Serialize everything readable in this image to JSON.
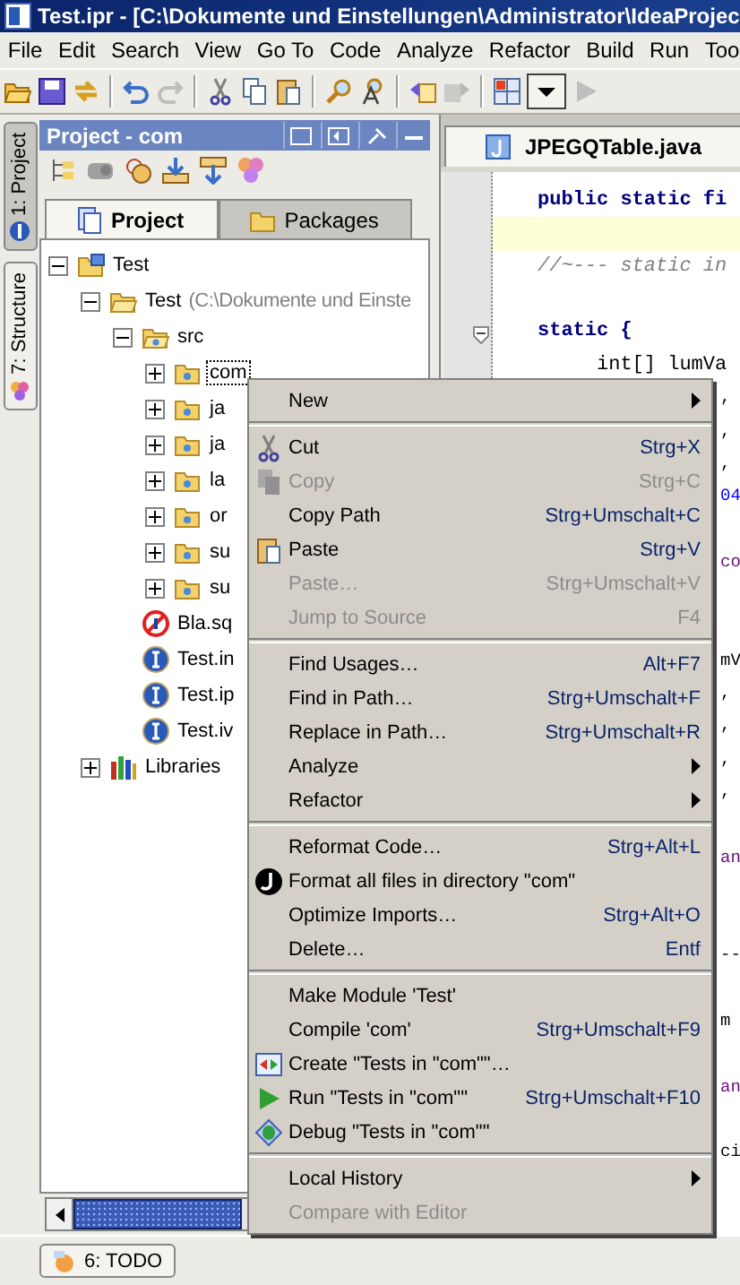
{
  "window": {
    "title": "Test.ipr - [C:\\Dokumente und Einstellungen\\Administrator\\IdeaProjec"
  },
  "menu_bar": [
    "File",
    "Edit",
    "Search",
    "View",
    "Go To",
    "Code",
    "Analyze",
    "Refactor",
    "Build",
    "Run",
    "Too"
  ],
  "toolbar": [
    {
      "kind": "open",
      "disabled": false
    },
    {
      "kind": "save",
      "disabled": false
    },
    {
      "kind": "sync",
      "disabled": false
    },
    {
      "kind": "separator"
    },
    {
      "kind": "undo",
      "disabled": false
    },
    {
      "kind": "redo",
      "disabled": true
    },
    {
      "kind": "separator"
    },
    {
      "kind": "cut",
      "disabled": false
    },
    {
      "kind": "copy",
      "disabled": false
    },
    {
      "kind": "paste",
      "disabled": false
    },
    {
      "kind": "separator"
    },
    {
      "kind": "find",
      "disabled": false
    },
    {
      "kind": "replace",
      "disabled": false
    },
    {
      "kind": "separator"
    },
    {
      "kind": "back",
      "disabled": false
    },
    {
      "kind": "forward",
      "disabled": true
    },
    {
      "kind": "separator"
    },
    {
      "kind": "structure",
      "disabled": false
    },
    {
      "kind": "dropdown",
      "disabled": false
    },
    {
      "kind": "run",
      "disabled": true
    }
  ],
  "tool_strip": [
    {
      "label": "1: Project",
      "selected": true
    },
    {
      "label": "7: Structure",
      "selected": false
    }
  ],
  "project_panel": {
    "title": "Project - com",
    "tabs": [
      {
        "label": "Project",
        "selected": true
      },
      {
        "label": "Packages",
        "selected": false
      }
    ],
    "tree": [
      {
        "label": "Test",
        "kind": "module",
        "expanded": true,
        "selected": false,
        "children": [
          {
            "label": "Test",
            "note": "(C:\\Dokumente und Einste",
            "kind": "folder",
            "expanded": true,
            "selected": false,
            "children": [
              {
                "label": "src",
                "kind": "source",
                "expanded": true,
                "selected": false,
                "children": [
                  {
                    "label": "com",
                    "kind": "package",
                    "expanded": false,
                    "selected": true
                  },
                  {
                    "label": "ja",
                    "kind": "package",
                    "expanded": false,
                    "selected": false
                  },
                  {
                    "label": "ja",
                    "kind": "package",
                    "expanded": false,
                    "selected": false
                  },
                  {
                    "label": "la",
                    "kind": "package",
                    "expanded": false,
                    "selected": false
                  },
                  {
                    "label": "or",
                    "kind": "package",
                    "expanded": false,
                    "selected": false
                  },
                  {
                    "label": "su",
                    "kind": "package",
                    "expanded": false,
                    "selected": false
                  },
                  {
                    "label": "su",
                    "kind": "package",
                    "expanded": false,
                    "selected": false
                  }
                ]
              },
              {
                "label": "Bla.sq",
                "kind": "sql",
                "selected": false
              },
              {
                "label": "Test.in",
                "kind": "idea",
                "selected": false
              },
              {
                "label": "Test.ip",
                "kind": "idea",
                "selected": false
              },
              {
                "label": "Test.iv",
                "kind": "idea",
                "selected": false
              }
            ]
          },
          {
            "label": "Libraries",
            "kind": "libraries",
            "expanded": false,
            "selected": false
          }
        ]
      }
    ]
  },
  "editor": {
    "tabs": [
      {
        "label": "JPEGQTable.java",
        "selected": true
      }
    ],
    "lines": [
      {
        "kind": "keyword",
        "text": "public static fi"
      },
      {
        "kind": "current"
      },
      {
        "kind": "comment",
        "text": "//~--- static in"
      },
      {
        "kind": "blank"
      },
      {
        "kind": "keyword",
        "text": "static {"
      },
      {
        "kind": "code",
        "text": "int[] lumVa"
      },
      {
        "kind": "punct",
        "text": ","
      },
      {
        "kind": "punct",
        "text": ","
      },
      {
        "kind": "punct",
        "text": ","
      },
      {
        "kind": "number",
        "text": "04"
      },
      {
        "kind": "blank"
      },
      {
        "kind": "field",
        "text": "co"
      },
      {
        "kind": "blank"
      },
      {
        "kind": "blank"
      },
      {
        "kind": "punct",
        "text": "mV"
      },
      {
        "kind": "punct",
        "text": ","
      },
      {
        "kind": "punct",
        "text": ","
      },
      {
        "kind": "punct",
        "text": ","
      },
      {
        "kind": "punct",
        "text": ","
      },
      {
        "kind": "blank"
      },
      {
        "kind": "field",
        "text": "an"
      },
      {
        "kind": "blank"
      },
      {
        "kind": "blank"
      },
      {
        "kind": "punct",
        "text": "--"
      },
      {
        "kind": "blank"
      },
      {
        "kind": "punct",
        "text": "m"
      },
      {
        "kind": "blank"
      },
      {
        "kind": "field",
        "text": "an"
      },
      {
        "kind": "blank"
      },
      {
        "kind": "punct",
        "text": "ci"
      }
    ]
  },
  "context_menu": [
    {
      "kind": "item",
      "label": "New",
      "submenu": true,
      "disabled": false
    },
    {
      "kind": "separator"
    },
    {
      "kind": "item",
      "label": "Cut",
      "shortcut": "Strg+X",
      "disabled": false
    },
    {
      "kind": "item",
      "label": "Copy",
      "shortcut": "Strg+C",
      "disabled": true
    },
    {
      "kind": "item",
      "label": "Copy Path",
      "shortcut": "Strg+Umschalt+C",
      "disabled": false
    },
    {
      "kind": "item",
      "label": "Paste",
      "shortcut": "Strg+V",
      "disabled": false
    },
    {
      "kind": "item",
      "label": "Paste…",
      "shortcut": "Strg+Umschalt+V",
      "disabled": true
    },
    {
      "kind": "item",
      "label": "Jump to Source",
      "shortcut": "F4",
      "disabled": true
    },
    {
      "kind": "separator"
    },
    {
      "kind": "item",
      "label": "Find Usages…",
      "shortcut": "Alt+F7",
      "disabled": false
    },
    {
      "kind": "item",
      "label": "Find in Path…",
      "shortcut": "Strg+Umschalt+F",
      "disabled": false
    },
    {
      "kind": "item",
      "label": "Replace in Path…",
      "shortcut": "Strg+Umschalt+R",
      "disabled": false
    },
    {
      "kind": "item",
      "label": "Analyze",
      "submenu": true,
      "disabled": false
    },
    {
      "kind": "item",
      "label": "Refactor",
      "submenu": true,
      "disabled": false
    },
    {
      "kind": "separator"
    },
    {
      "kind": "item",
      "label": "Reformat Code…",
      "shortcut": "Strg+Alt+L",
      "disabled": false
    },
    {
      "kind": "item",
      "label": "Format all files in directory \"com\"",
      "disabled": false
    },
    {
      "kind": "item",
      "label": "Optimize Imports…",
      "shortcut": "Strg+Alt+O",
      "disabled": false
    },
    {
      "kind": "item",
      "label": "Delete…",
      "shortcut": "Entf",
      "disabled": false
    },
    {
      "kind": "separator"
    },
    {
      "kind": "item",
      "label": "Make Module 'Test'",
      "disabled": false
    },
    {
      "kind": "item",
      "label": "Compile 'com'",
      "shortcut": "Strg+Umschalt+F9",
      "disabled": false
    },
    {
      "kind": "item",
      "label": "Create  \"Tests in \"com\"\"…",
      "disabled": false
    },
    {
      "kind": "item",
      "label": "Run \"Tests in \"com\"\"",
      "shortcut": "Strg+Umschalt+F10",
      "disabled": false
    },
    {
      "kind": "item",
      "label": "Debug \"Tests in \"com\"\"",
      "disabled": false
    },
    {
      "kind": "separator"
    },
    {
      "kind": "item",
      "label": "Local History",
      "submenu": true,
      "disabled": false
    },
    {
      "kind": "item",
      "label": "Compare with Editor",
      "disabled": true
    }
  ],
  "bottom_bar": [
    {
      "label": "6: TODO"
    }
  ]
}
